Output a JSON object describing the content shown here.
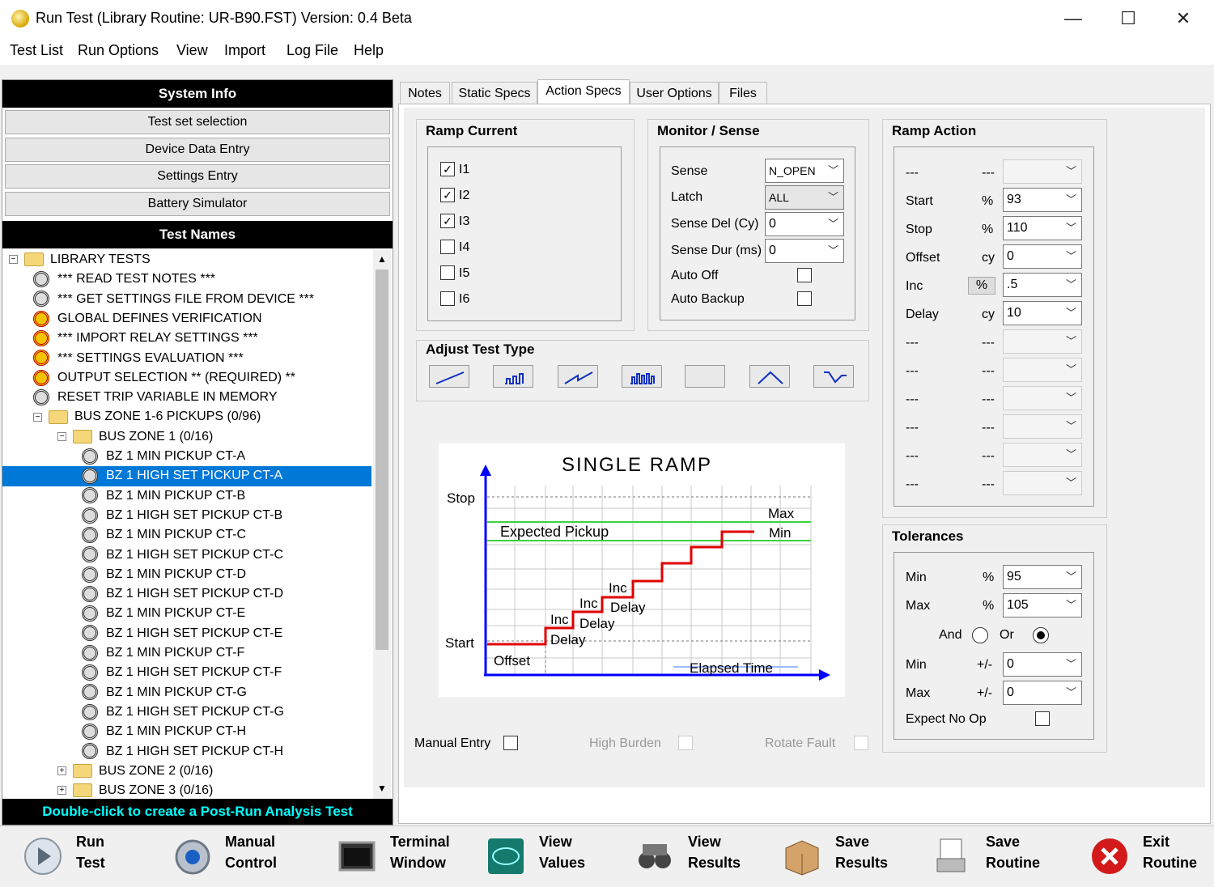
{
  "window": {
    "title": "Run Test (Library Routine: UR-B90.FST)  Version: 0.4 Beta",
    "minimize": "—",
    "maximize": "☐",
    "close": "✕"
  },
  "menu": [
    "Test List",
    "Run Options",
    "View",
    "Import",
    "Log File",
    "Help"
  ],
  "left": {
    "system_info": "System Info",
    "nav": [
      "Test set selection",
      "Device Data Entry",
      "Settings Entry",
      "Battery Simulator"
    ],
    "test_names": "Test Names",
    "tree": [
      {
        "label": "LIBRARY TESTS",
        "type": "folder",
        "level": 0,
        "exp": "−"
      },
      {
        "label": "*** READ TEST NOTES ***",
        "type": "gear",
        "level": 1
      },
      {
        "label": "*** GET SETTINGS FILE FROM DEVICE ***",
        "type": "gear",
        "level": 1
      },
      {
        "label": "GLOBAL DEFINES VERIFICATION",
        "type": "gear-y",
        "level": 1
      },
      {
        "label": "*** IMPORT RELAY SETTINGS ***",
        "type": "gear-y",
        "level": 1
      },
      {
        "label": "*** SETTINGS EVALUATION ***",
        "type": "gear-y",
        "level": 1
      },
      {
        "label": "OUTPUT SELECTION  ** (REQUIRED) **",
        "type": "gear-y",
        "level": 1
      },
      {
        "label": "RESET TRIP VARIABLE IN MEMORY",
        "type": "gear",
        "level": 1
      },
      {
        "label": "BUS ZONE 1-6 PICKUPS (0/96)",
        "type": "folder",
        "level": 1,
        "exp": "−"
      },
      {
        "label": "BUS ZONE 1 (0/16)",
        "type": "folder",
        "level": 2,
        "exp": "−"
      },
      {
        "label": "BZ 1 MIN PICKUP CT-A",
        "type": "gear",
        "level": 3
      },
      {
        "label": "BZ 1 HIGH SET PICKUP CT-A",
        "type": "gear",
        "level": 3,
        "selected": true
      },
      {
        "label": "BZ 1 MIN PICKUP CT-B",
        "type": "gear",
        "level": 3
      },
      {
        "label": "BZ 1 HIGH SET PICKUP CT-B",
        "type": "gear",
        "level": 3
      },
      {
        "label": "BZ 1 MIN PICKUP CT-C",
        "type": "gear",
        "level": 3
      },
      {
        "label": "BZ 1 HIGH SET PICKUP CT-C",
        "type": "gear",
        "level": 3
      },
      {
        "label": "BZ 1 MIN PICKUP CT-D",
        "type": "gear",
        "level": 3
      },
      {
        "label": "BZ 1 HIGH SET PICKUP CT-D",
        "type": "gear",
        "level": 3
      },
      {
        "label": "BZ 1 MIN PICKUP CT-E",
        "type": "gear",
        "level": 3
      },
      {
        "label": "BZ 1 HIGH SET PICKUP CT-E",
        "type": "gear",
        "level": 3
      },
      {
        "label": "BZ 1 MIN PICKUP CT-F",
        "type": "gear",
        "level": 3
      },
      {
        "label": "BZ 1 HIGH SET PICKUP CT-F",
        "type": "gear",
        "level": 3
      },
      {
        "label": "BZ 1 MIN PICKUP CT-G",
        "type": "gear",
        "level": 3
      },
      {
        "label": "BZ 1 HIGH SET PICKUP CT-G",
        "type": "gear",
        "level": 3
      },
      {
        "label": "BZ 1 MIN PICKUP CT-H",
        "type": "gear",
        "level": 3
      },
      {
        "label": "BZ 1 HIGH SET PICKUP CT-H",
        "type": "gear",
        "level": 3
      },
      {
        "label": "BUS ZONE 2 (0/16)",
        "type": "folder",
        "level": 2,
        "exp": "+"
      },
      {
        "label": "BUS ZONE 3 (0/16)",
        "type": "folder",
        "level": 2,
        "exp": "+"
      }
    ],
    "footer": "Double-click to create a Post-Run Analysis Test"
  },
  "tabs": [
    {
      "label": "Notes",
      "active": false
    },
    {
      "label": "Static Specs",
      "active": false
    },
    {
      "label": "Action Specs",
      "active": true
    },
    {
      "label": "User Options",
      "active": false
    },
    {
      "label": "Files",
      "active": false
    }
  ],
  "ramp_current": {
    "title": "Ramp Current",
    "items": [
      {
        "label": "I1",
        "checked": true
      },
      {
        "label": "I2",
        "checked": true
      },
      {
        "label": "I3",
        "checked": true
      },
      {
        "label": "I4",
        "checked": false
      },
      {
        "label": "I5",
        "checked": false
      },
      {
        "label": "I6",
        "checked": false
      }
    ]
  },
  "monitor": {
    "title": "Monitor / Sense",
    "sense_label": "Sense",
    "sense_value": "N_OPEN",
    "latch_label": "Latch",
    "latch_value": "ALL",
    "sense_del_label": "Sense Del (Cy)",
    "sense_del_value": "0",
    "sense_dur_label": "Sense Dur (ms)",
    "sense_dur_value": "0",
    "auto_off_label": "Auto Off",
    "auto_backup_label": "Auto Backup"
  },
  "adjust": {
    "title": "Adjust Test Type",
    "types": [
      "single-ramp-icon",
      "pulse-ramp-icon",
      "double-ramp-icon",
      "multi-pulse-icon",
      "blank-type-icon",
      "peak-icon",
      "step-down-icon"
    ]
  },
  "diagram": {
    "title": "SINGLE  RAMP",
    "stop": "Stop",
    "start": "Start",
    "max": "Max",
    "min": "Min",
    "expected": "Expected Pickup",
    "offset": "Offset",
    "elapsed": "Elapsed Time",
    "inc": "Inc",
    "delay": "Delay"
  },
  "ramp_action": {
    "title": "Ramp Action",
    "rows": [
      {
        "label": "---",
        "unit": "---",
        "value": "",
        "enabled": false
      },
      {
        "label": "Start",
        "unit": "%",
        "value": "93",
        "enabled": true
      },
      {
        "label": "Stop",
        "unit": "%",
        "value": "110",
        "enabled": true
      },
      {
        "label": "Offset",
        "unit": "cy",
        "value": "0",
        "enabled": true
      },
      {
        "label": "Inc",
        "unit": "%",
        "value": ".5",
        "enabled": true,
        "unit_button": true
      },
      {
        "label": "Delay",
        "unit": "cy",
        "value": "10",
        "enabled": true
      },
      {
        "label": "---",
        "unit": "---",
        "value": "",
        "enabled": false
      },
      {
        "label": "---",
        "unit": "---",
        "value": "",
        "enabled": false
      },
      {
        "label": "---",
        "unit": "---",
        "value": "",
        "enabled": false
      },
      {
        "label": "---",
        "unit": "---",
        "value": "",
        "enabled": false
      },
      {
        "label": "---",
        "unit": "---",
        "value": "",
        "enabled": false
      },
      {
        "label": "---",
        "unit": "---",
        "value": "",
        "enabled": false
      }
    ]
  },
  "tolerances": {
    "title": "Tolerances",
    "min_label": "Min",
    "min_unit": "%",
    "min_value": "95",
    "max_label": "Max",
    "max_unit": "%",
    "max_value": "105",
    "and_label": "And",
    "or_label": "Or",
    "or_selected": true,
    "min2_label": "Min",
    "min2_unit": "+/-",
    "min2_value": "0",
    "max2_label": "Max",
    "max2_unit": "+/-",
    "max2_value": "0",
    "expect_label": "Expect No Op"
  },
  "options": {
    "manual_entry": "Manual Entry",
    "high_burden": "High Burden",
    "rotate_fault": "Rotate Fault"
  },
  "toolbar": [
    {
      "l1": "Run",
      "l2": "Test",
      "icon": "play-icon"
    },
    {
      "l1": "Manual",
      "l2": "Control",
      "icon": "manual-control-icon"
    },
    {
      "l1": "Terminal",
      "l2": "Window",
      "icon": "terminal-icon"
    },
    {
      "l1": "View",
      "l2": "Values",
      "icon": "values-icon"
    },
    {
      "l1": "View",
      "l2": "Results",
      "icon": "binoculars-icon"
    },
    {
      "l1": "Save",
      "l2": "Results",
      "icon": "box-icon"
    },
    {
      "l1": "Save",
      "l2": "Routine",
      "icon": "save-routine-icon"
    },
    {
      "l1": "Exit",
      "l2": "Routine",
      "icon": "exit-icon"
    }
  ],
  "colors": {
    "selection": "#0078d7",
    "footer_text": "#00ffff",
    "ramp_red": "#e00000",
    "axis_blue": "#0000ff",
    "pickup_green": "#40d040"
  }
}
